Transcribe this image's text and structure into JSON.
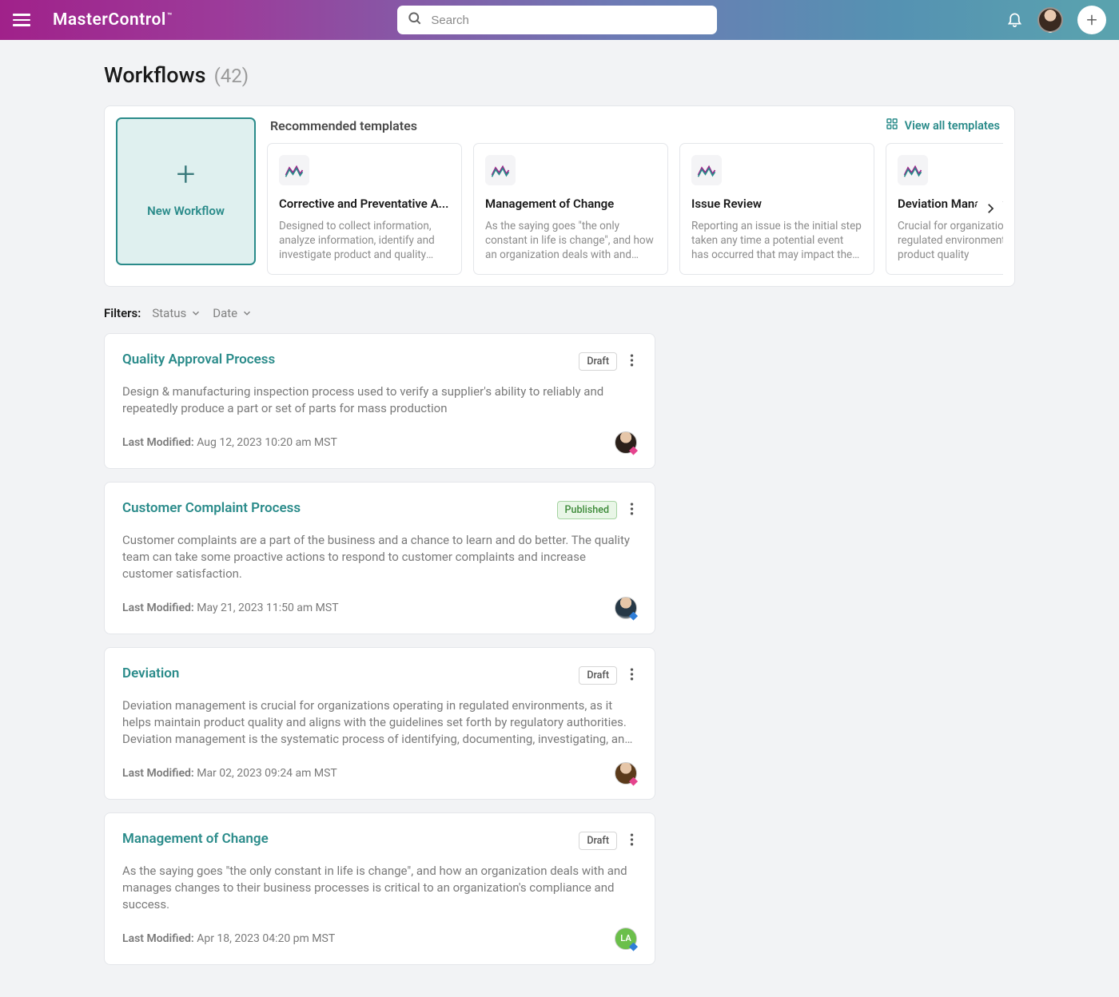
{
  "brand": "MasterControl",
  "search": {
    "placeholder": "Search"
  },
  "page": {
    "title": "Workflows",
    "count": "(42)"
  },
  "templates": {
    "heading": "Recommended templates",
    "viewAll": "View all templates",
    "newLabel": "New Workflow",
    "items": [
      {
        "title": "Corrective and Preventative A...",
        "desc": "Designed to collect information, analyze information, identify and investigate product and quality problems"
      },
      {
        "title": "Management of Change",
        "desc": "As the saying goes \"the only constant in life is change\", and how an organization deals with and manages"
      },
      {
        "title": "Issue Review",
        "desc": "Reporting an issue is the initial step taken any time a potential event has occurred that may impact the quality"
      },
      {
        "title": "Deviation Management",
        "desc": "Crucial for organizations in regulated environments to maintain product quality"
      }
    ]
  },
  "filters": {
    "label": "Filters:",
    "status": "Status",
    "date": "Date"
  },
  "statusLabels": {
    "draft": "Draft",
    "published": "Published"
  },
  "workflows": [
    {
      "title": "Quality Approval Process",
      "status": "Draft",
      "desc": "Design & manufacturing inspection process used to verify a supplier's ability to reliably and repeatedly produce a part or set of parts for mass production",
      "lastModifiedLabel": "Last Modified:",
      "lastModified": "Aug 12, 2023 10:20 am MST",
      "avatarClass": "a1",
      "avatarText": ""
    },
    {
      "title": "Customer Complaint Process",
      "status": "Published",
      "desc": "Customer complaints are a part of the business and a chance to learn and do better. The quality team can take some proactive actions to respond to customer complaints and increase customer satisfaction.",
      "lastModifiedLabel": "Last Modified:",
      "lastModified": "May 21, 2023 11:50 am MST",
      "avatarClass": "a2 blue",
      "avatarText": ""
    },
    {
      "title": "Deviation",
      "status": "Draft",
      "desc": "Deviation management is crucial for organizations operating in regulated environments, as it helps maintain product quality and aligns with the guidelines set forth by regulatory authorities. Deviation management is the systematic process of identifying, documenting, investigating, and addressing any unexpected or unplanned...",
      "lastModifiedLabel": "Last Modified:",
      "lastModified": "Mar 02, 2023 09:24 am MST",
      "avatarClass": "a3",
      "avatarText": ""
    },
    {
      "title": "Management of Change",
      "status": "Draft",
      "desc": "As the saying goes \"the only constant in life is change\", and how an organization deals with and manages changes to their business processes is critical to an organization's compliance and success.",
      "lastModifiedLabel": "Last Modified:",
      "lastModified": "Apr 18, 2023 04:20 pm MST",
      "avatarClass": "green",
      "avatarText": "LA"
    }
  ]
}
